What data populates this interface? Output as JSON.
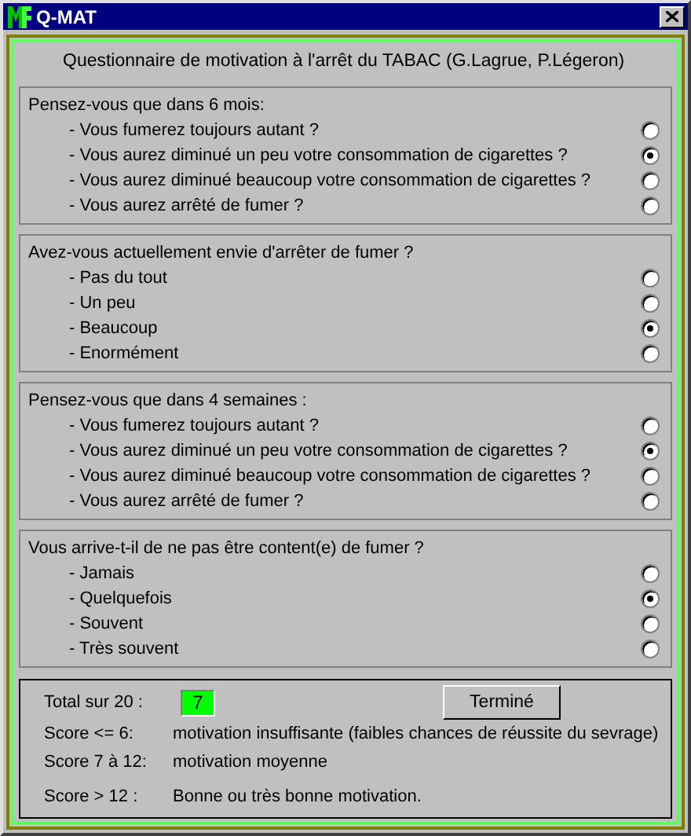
{
  "window": {
    "title": "Q-MAT"
  },
  "header": "Questionnaire de motivation à l'arrêt du TABAC (G.Lagrue, P.Légeron)",
  "questions": [
    {
      "prompt": "Pensez-vous que dans 6 mois:",
      "options": [
        {
          "label": "- Vous fumerez toujours autant ?",
          "selected": false
        },
        {
          "label": "- Vous aurez diminué un peu votre consommation de cigarettes ?",
          "selected": true
        },
        {
          "label": "- Vous aurez diminué beaucoup votre consommation de cigarettes ?",
          "selected": false
        },
        {
          "label": "- Vous aurez arrêté de fumer ?",
          "selected": false
        }
      ]
    },
    {
      "prompt": "Avez-vous actuellement envie d'arrêter de fumer ?",
      "options": [
        {
          "label": "- Pas du tout",
          "selected": false
        },
        {
          "label": "- Un peu",
          "selected": false
        },
        {
          "label": "- Beaucoup",
          "selected": true
        },
        {
          "label": "- Enormément",
          "selected": false
        }
      ]
    },
    {
      "prompt": "Pensez-vous que dans 4 semaines :",
      "options": [
        {
          "label": "- Vous fumerez toujours autant ?",
          "selected": false
        },
        {
          "label": "- Vous aurez diminué un peu votre consommation de cigarettes ?",
          "selected": true
        },
        {
          "label": "- Vous aurez diminué beaucoup votre consommation de cigarettes ?",
          "selected": false
        },
        {
          "label": "- Vous aurez arrêté de fumer ?",
          "selected": false
        }
      ]
    },
    {
      "prompt": "Vous arrive-t-il de ne pas être content(e) de fumer ?",
      "options": [
        {
          "label": "- Jamais",
          "selected": false
        },
        {
          "label": "- Quelquefois",
          "selected": true
        },
        {
          "label": "- Souvent",
          "selected": false
        },
        {
          "label": "- Très souvent",
          "selected": false
        }
      ]
    }
  ],
  "total": {
    "label": "Total sur 20 :",
    "value": "7",
    "button": "Terminé"
  },
  "legend": [
    {
      "range": "Score <= 6:",
      "text": "motivation insuffisante (faibles chances de réussite du sevrage)"
    },
    {
      "range": "Score 7 à 12:",
      "text": "motivation moyenne"
    },
    {
      "range": "Score > 12 :",
      "text": "Bonne ou très bonne motivation."
    }
  ]
}
